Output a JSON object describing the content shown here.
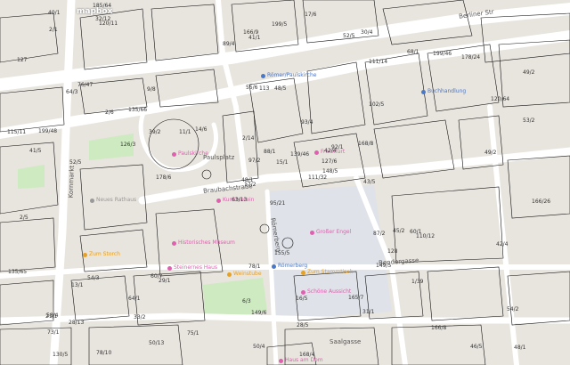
{
  "logo": "mapbox",
  "colors": {
    "road": "#ffffff",
    "block": "#e8e4de",
    "park": "#cdeac0",
    "plaza": "#dfe2e8",
    "parcel": "#111111",
    "poi_pink": "#e060b0",
    "poi_blue": "#4a78c8",
    "poi_orange": "#e8a020"
  },
  "streets": [
    {
      "id": "berliner-str",
      "text": "Berliner Str"
    },
    {
      "id": "roemerberg",
      "text": "Römerberg"
    },
    {
      "id": "braubachstr",
      "text": "Braubachstraße"
    },
    {
      "id": "bendergasse",
      "text": "Bendergasse"
    },
    {
      "id": "saalgasse",
      "text": "Saalgasse"
    },
    {
      "id": "paulsplatz",
      "text": "Paulsplatz"
    },
    {
      "id": "kornmarkt",
      "text": "Kornmarkt"
    }
  ],
  "pois": [
    {
      "text": "Paulskirche",
      "color": "#e060b0"
    },
    {
      "text": "Römer/Paulskirche",
      "color": "#4a78c8"
    },
    {
      "text": "Neues Rathaus",
      "color": "#999999"
    },
    {
      "text": "Römerberg",
      "color": "#4a78c8"
    },
    {
      "text": "Großer Engel",
      "color": "#e060b0"
    },
    {
      "text": "Zum Stammtisch",
      "color": "#e8a020"
    },
    {
      "text": "Schöne Aussicht",
      "color": "#e060b0"
    },
    {
      "text": "Kunstverein",
      "color": "#e060b0"
    },
    {
      "text": "Historisches Museum",
      "color": "#e060b0"
    },
    {
      "text": "Steinernes Haus",
      "color": "#e060b0"
    },
    {
      "text": "Zum Storch",
      "color": "#e8a020"
    },
    {
      "text": "Haus am Dom",
      "color": "#e060b0"
    },
    {
      "text": "Weinstube",
      "color": "#e8a020"
    },
    {
      "text": "Frankfurt",
      "color": "#e060b0"
    },
    {
      "text": "Buchhandlung",
      "color": "#4a78c8"
    }
  ],
  "parcel_labels": [
    "95/21",
    "64/3",
    "17/2",
    "58/4",
    "42/4",
    "29/1",
    "30/4",
    "48/5",
    "111/14",
    "111/32",
    "120/11",
    "48/1",
    "52/5",
    "49/2",
    "63/13",
    "102/5",
    "78/10",
    "55/6",
    "93/4",
    "54/3",
    "14/6",
    "73/1",
    "33/2",
    "113",
    "92/1",
    "110/12",
    "76/47",
    "41/1",
    "41/5",
    "87/2",
    "53/2",
    "48/1",
    "6/3",
    "97/2",
    "9/8",
    "68/1",
    "60/7",
    "46/5",
    "54/2",
    "60/1",
    "17/6",
    "11/1",
    "126/3",
    "149/5",
    "50/13",
    "115/11",
    "127/6",
    "130/5",
    "149/6",
    "148/5",
    "13/1",
    "120/64",
    "127",
    "128",
    "31/1",
    "64/1",
    "32/12",
    "40/1",
    "16/5",
    "178/24",
    "199/5",
    "178/6",
    "199/48",
    "135/66",
    "199/46",
    "185/64",
    "52/5",
    "89/4",
    "88/1",
    "135/65",
    "78/1",
    "75/1",
    "45/2",
    "39/2",
    "21/1",
    "2/1",
    "2/6",
    "2/5",
    "2/14",
    "28/5",
    "139/46",
    "28/13",
    "43/5",
    "42/4",
    "50/4",
    "49/2",
    "155/5",
    "166/8",
    "168/4",
    "165/7",
    "166/9",
    "166/26",
    "168/8",
    "1/39",
    "15/1"
  ]
}
